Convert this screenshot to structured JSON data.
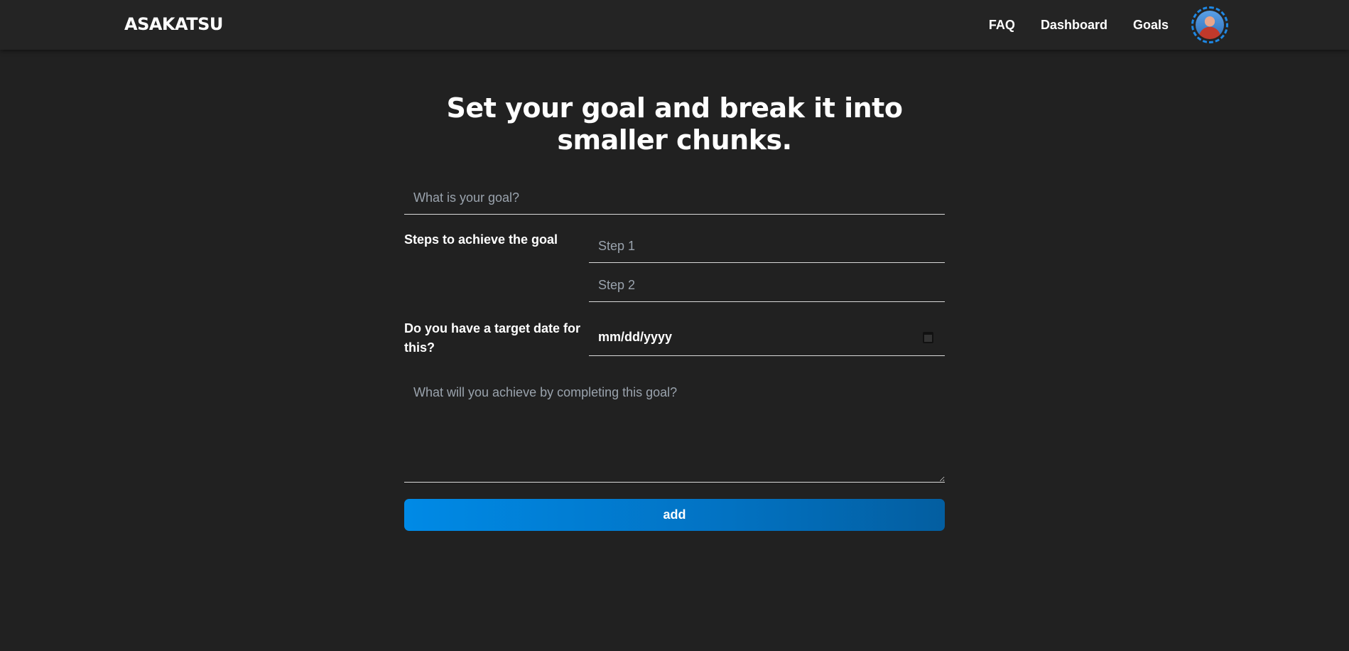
{
  "navbar": {
    "logo": "ASAKATSU",
    "links": [
      {
        "label": "FAQ"
      },
      {
        "label": "Dashboard"
      },
      {
        "label": "Goals"
      }
    ],
    "avatar_icon": "user-avatar"
  },
  "main": {
    "heading": "Set your goal and break it into smaller chunks.",
    "goal_input": {
      "placeholder": "What is your goal?",
      "value": ""
    },
    "steps": {
      "label": "Steps to achieve the goal",
      "inputs": [
        {
          "placeholder": "Step 1",
          "value": ""
        },
        {
          "placeholder": "Step 2",
          "value": ""
        }
      ]
    },
    "target_date": {
      "label": "Do you have a target date for this?",
      "value": "mm/dd/yyyy",
      "icon": "calendar-icon"
    },
    "outcome": {
      "placeholder": "What will you achieve by completing this goal?",
      "value": ""
    },
    "add_button": {
      "label": "add"
    }
  },
  "colors": {
    "background": "#212121",
    "navbar": "#242424",
    "accent": "#008ae6",
    "text": "#ffffff",
    "placeholder": "#9aa3ad"
  }
}
